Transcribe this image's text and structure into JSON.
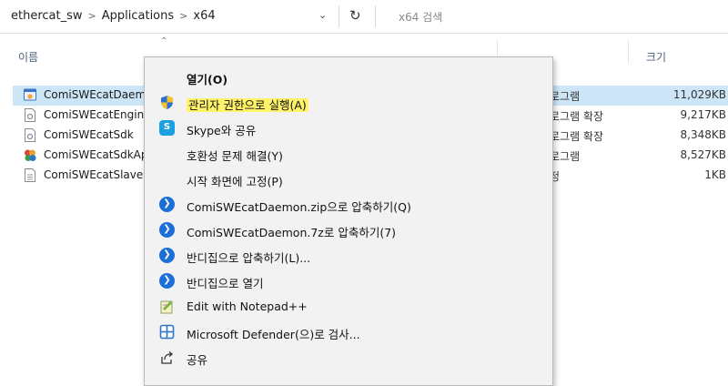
{
  "address_bar": {
    "breadcrumbs": [
      "ethercat_sw",
      "Applications",
      "x64"
    ],
    "separator": ">",
    "dropdown_icon": "chevron-down-icon",
    "refresh_icon": "refresh-icon",
    "search_placeholder": "x64 검색"
  },
  "columns": {
    "name": "이름",
    "size": "크기"
  },
  "files": [
    {
      "name": "ComiSWEcatDaemon",
      "type": "로그램",
      "size": "11,029KB",
      "icon": "exe-icon",
      "selected": true
    },
    {
      "name": "ComiSWEcatEngine",
      "type": "로그램 확장",
      "size": "9,217KB",
      "icon": "dll-icon"
    },
    {
      "name": "ComiSWEcatSdk",
      "type": "로그램 확장",
      "size": "8,348KB",
      "icon": "dll-icon"
    },
    {
      "name": "ComiSWEcatSdkApp",
      "type": "로그램",
      "size": "8,527KB",
      "icon": "app-icon"
    },
    {
      "name": "ComiSWEcatSlave",
      "type": "정",
      "size": "1KB",
      "icon": "config-icon"
    }
  ],
  "context_menu": {
    "items": [
      {
        "label": "열기(O)",
        "icon": "",
        "bold": true
      },
      {
        "label": "관리자 권한으로 실행(A)",
        "icon": "uac-shield-icon",
        "highlight": true
      },
      {
        "label": "Skype와 공유",
        "icon": "skype-icon"
      },
      {
        "label": "호환성 문제 해결(Y)",
        "icon": ""
      },
      {
        "label": "시작 화면에 고정(P)",
        "icon": ""
      },
      {
        "label": "ComiSWEcatDaemon.zip으로 압축하기(Q)",
        "icon": "bandizip-icon"
      },
      {
        "label": "ComiSWEcatDaemon.7z로 압축하기(7)",
        "icon": "bandizip-icon"
      },
      {
        "label": "반디집으로 압축하기(L)...",
        "icon": "bandizip-icon"
      },
      {
        "label": "반디집으로 열기",
        "icon": "bandizip-icon"
      },
      {
        "label": "Edit with Notepad++",
        "icon": "notepadpp-icon"
      },
      {
        "label": "Microsoft Defender(으)로 검사...",
        "icon": "defender-icon"
      },
      {
        "label": "공유",
        "icon": "share-icon"
      }
    ]
  }
}
